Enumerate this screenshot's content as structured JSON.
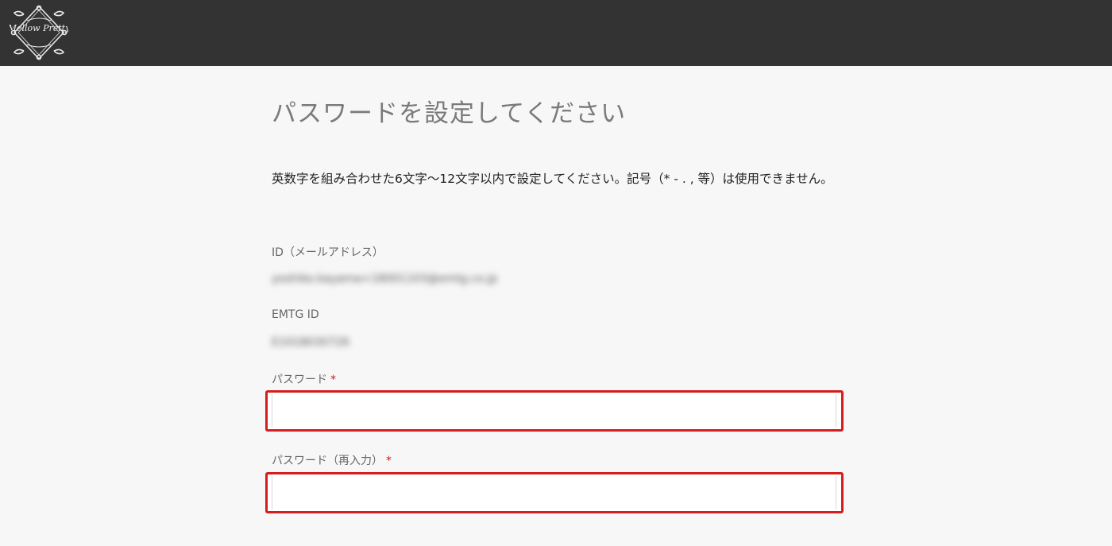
{
  "header": {
    "logo_icon": "mellow-pretty-crest-logo",
    "logo_text": "Mellow Pretty"
  },
  "main": {
    "title": "パスワードを設定してください",
    "instruction": "英数字を組み合わせた6文字～12文字以内で設定してください。記号（* - . , 等）は使用できません。",
    "id_label": "ID（メールアドレス）",
    "id_value": "yoshiko.kayama+18001103@emtg.co.jp",
    "emtg_label": "EMTG ID",
    "emtg_value": "E1018030726",
    "password_label": "パスワード",
    "password_confirm_label": "パスワード（再入力）",
    "required_mark": "*",
    "password_value": "",
    "password_confirm_value": ""
  },
  "colors": {
    "header_bg": "#333333",
    "page_bg": "#f7f7f7",
    "error_border": "#d41d1d",
    "required": "#d0181a"
  }
}
